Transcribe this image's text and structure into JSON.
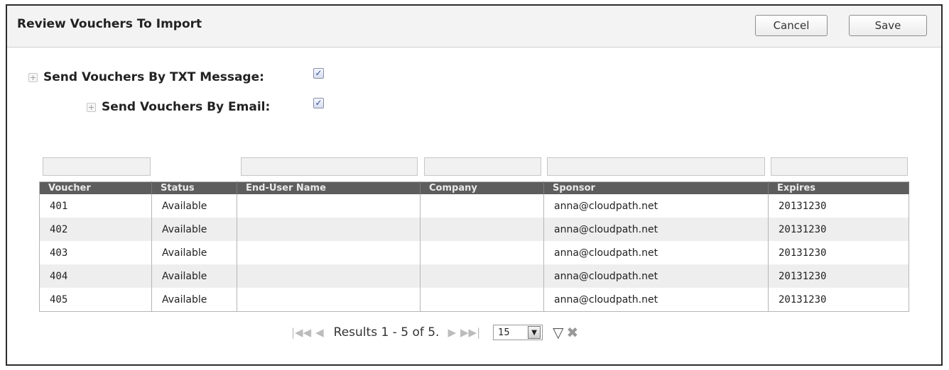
{
  "header": {
    "title": "Review Vouchers To Import",
    "cancel_label": "Cancel",
    "save_label": "Save"
  },
  "options": {
    "expander_glyph": "+",
    "txt_label": "Send Vouchers By TXT Message:",
    "txt_checked": true,
    "email_label": "Send Vouchers By Email:",
    "email_checked": true,
    "check_glyph": "✓"
  },
  "table": {
    "columns": [
      "Voucher",
      "Status",
      "End-User Name",
      "Company",
      "Sponsor",
      "Expires"
    ],
    "rows": [
      [
        "401",
        "Available",
        "",
        "",
        "anna@cloudpath.net",
        "20131230"
      ],
      [
        "402",
        "Available",
        "",
        "",
        "anna@cloudpath.net",
        "20131230"
      ],
      [
        "403",
        "Available",
        "",
        "",
        "anna@cloudpath.net",
        "20131230"
      ],
      [
        "404",
        "Available",
        "",
        "",
        "anna@cloudpath.net",
        "20131230"
      ],
      [
        "405",
        "Available",
        "",
        "",
        "anna@cloudpath.net",
        "20131230"
      ]
    ]
  },
  "pager": {
    "first_icon": "first-page-icon",
    "prev_icon": "prev-page-icon",
    "results_text": "Results 1 - 5 of 5.",
    "next_icon": "next-page-icon",
    "last_icon": "last-page-icon",
    "page_size": "15",
    "filter_icon": "filter-icon",
    "clear_filter_icon": "clear-filter-icon"
  },
  "colors": {
    "header_bg": "#f3f3f3",
    "table_header_bg": "#5d5d5d",
    "alt_row_bg": "#eeeeee"
  }
}
